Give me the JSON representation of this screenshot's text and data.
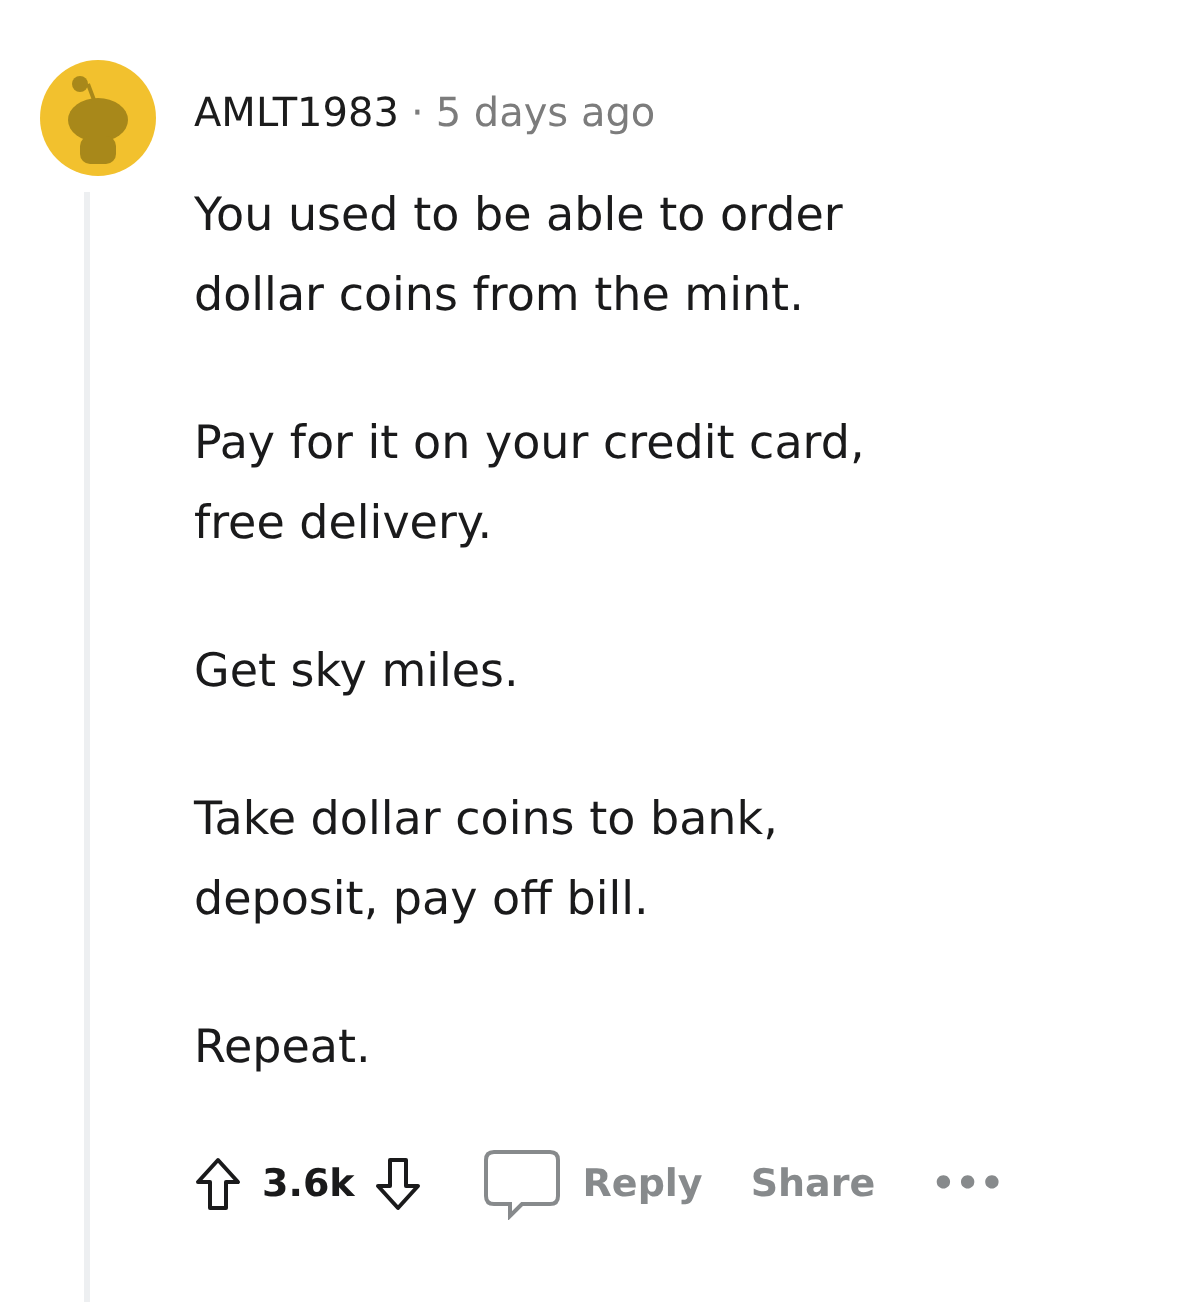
{
  "comment": {
    "author": "AMLT1983",
    "separator": "·",
    "time": "5 days ago",
    "paragraphs": [
      "You used to be able to order\ndollar coins from the mint.",
      "Pay for it on your credit card,\nfree delivery.",
      "Get sky miles.",
      "Take dollar coins to bank,\ndeposit, pay off bill.",
      "Repeat."
    ],
    "votes": "3.6k",
    "actions": [
      "Reply",
      "Share"
    ],
    "more": "•••"
  }
}
